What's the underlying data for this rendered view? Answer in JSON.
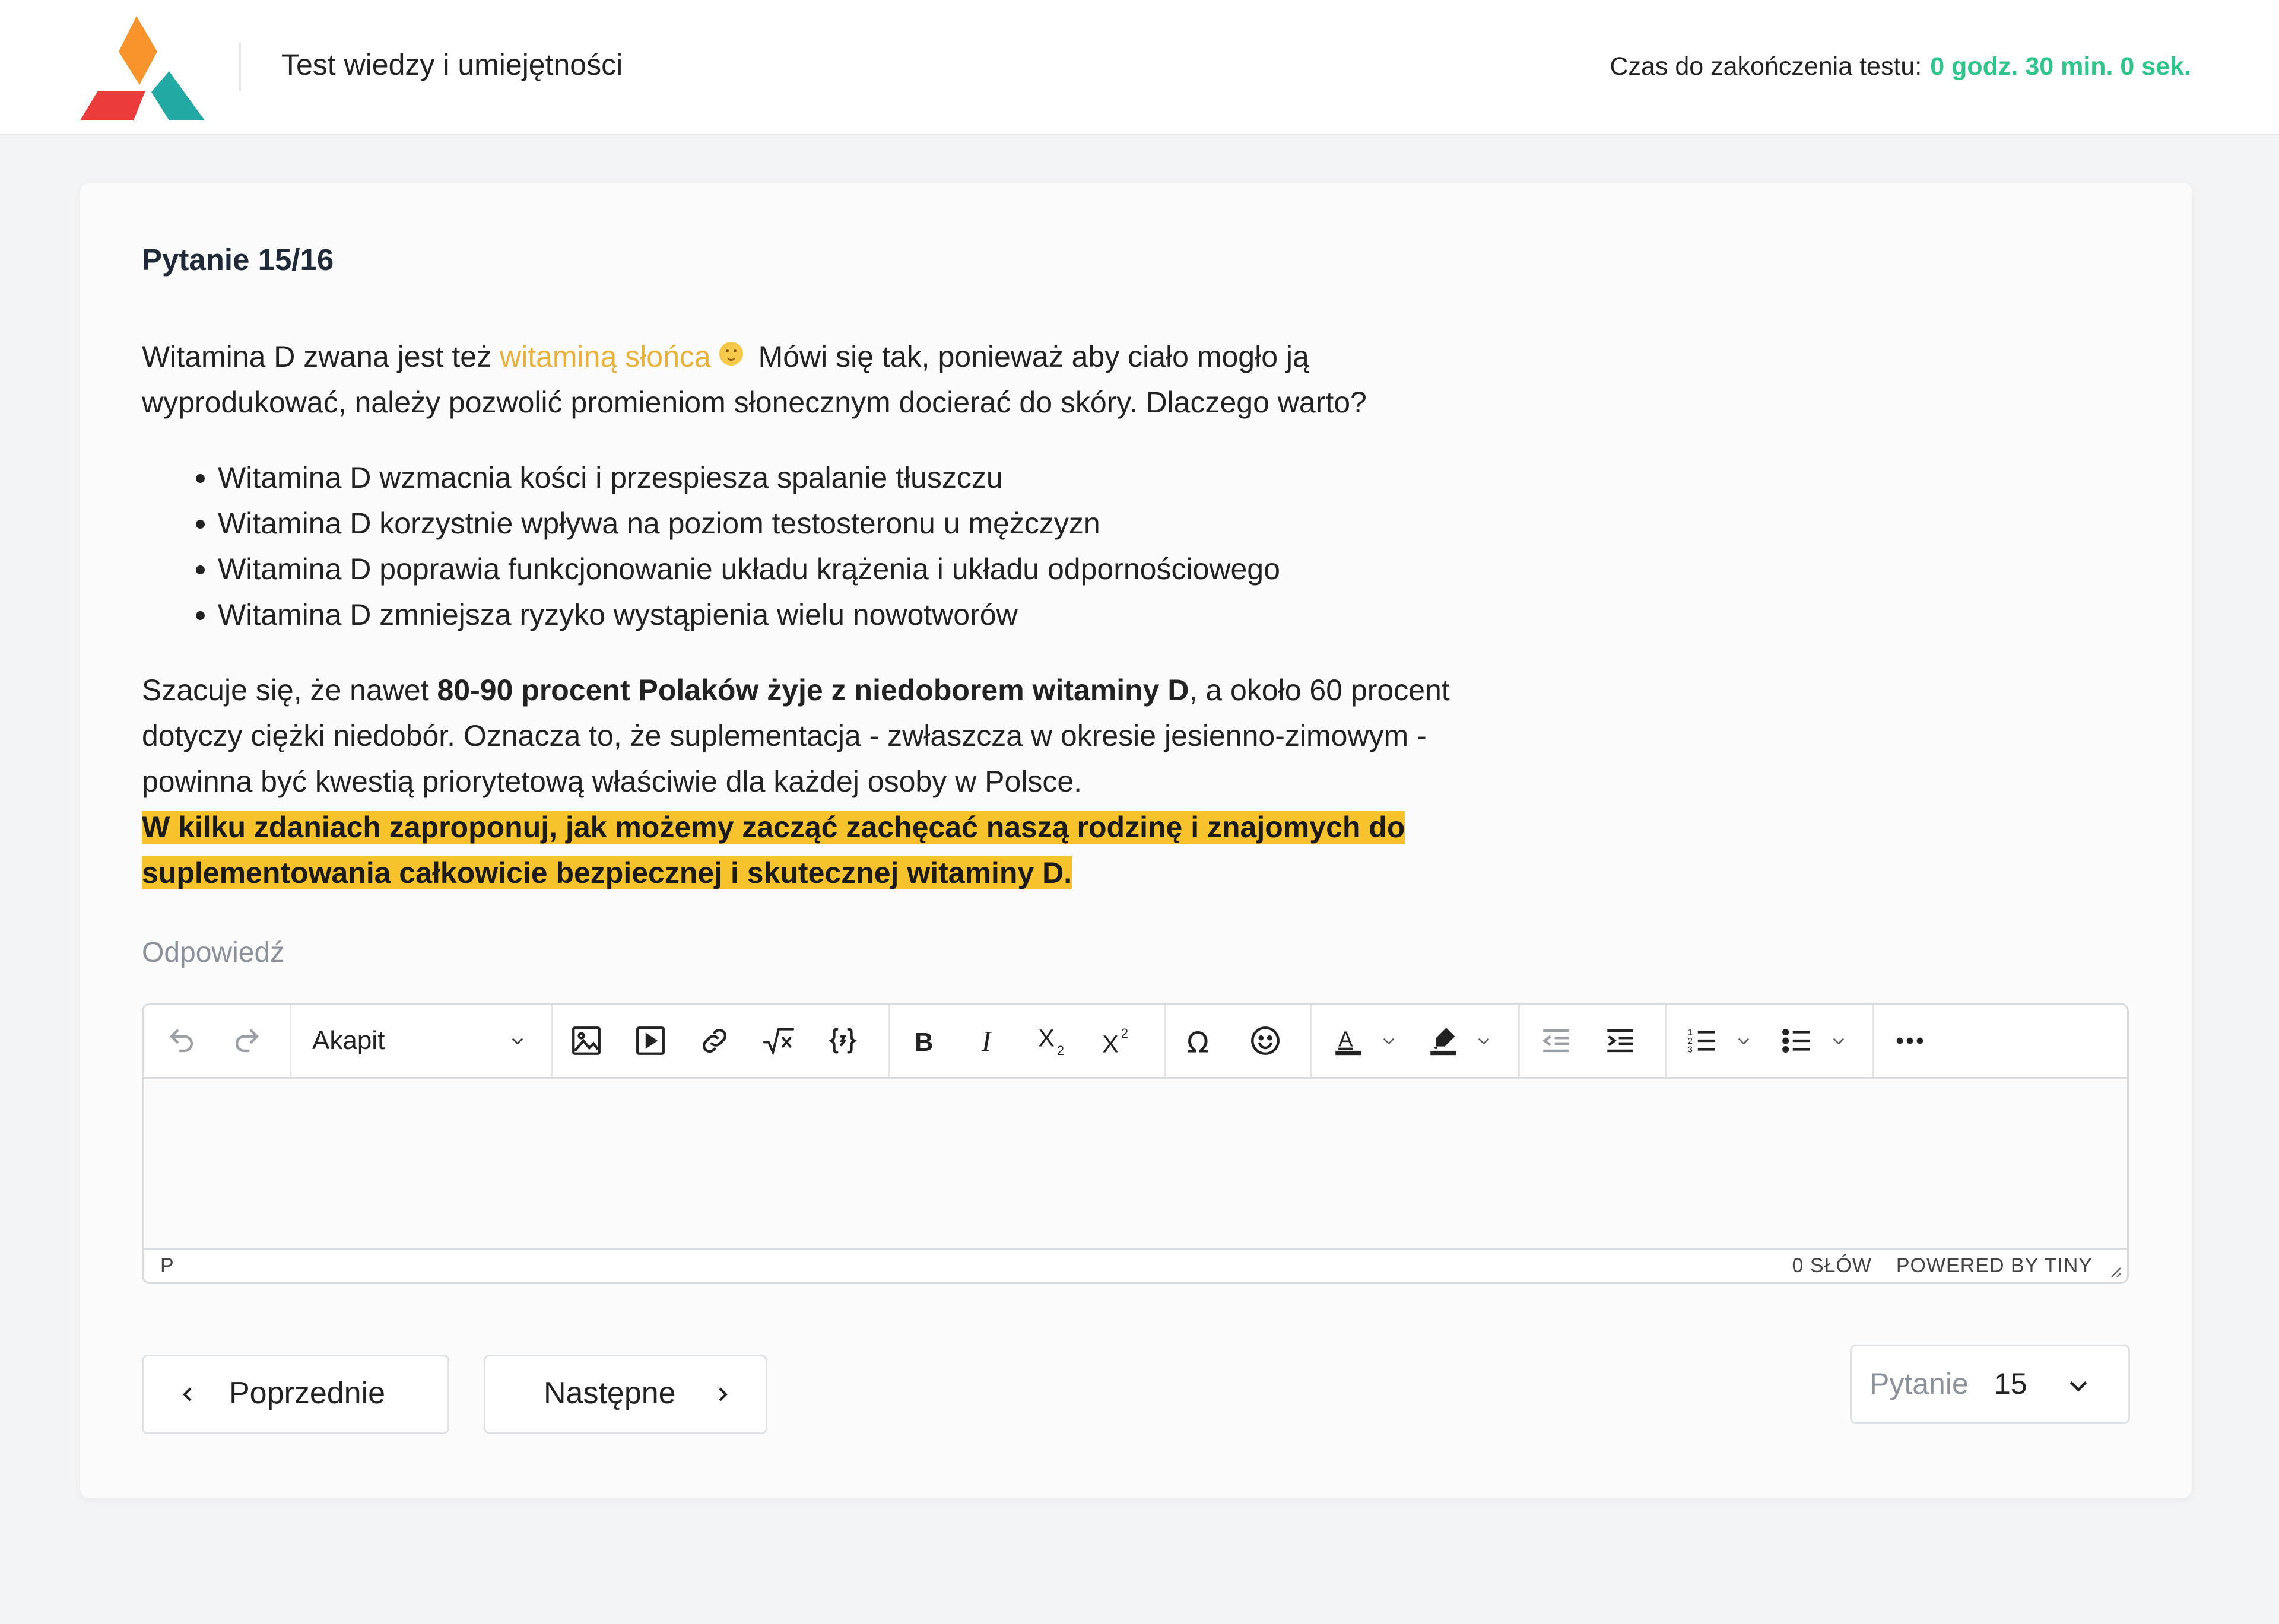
{
  "header": {
    "app_title": "Test wiedzy i umiejętności",
    "timer_label": "Czas do zakończenia testu:",
    "timer_value": "0 godz. 30 min. 0 sek.",
    "logo_icon": "triangle-logo-icon",
    "colors": {
      "logo_orange": "#f7942b",
      "logo_red": "#ec3b3b",
      "logo_teal": "#23a9a4",
      "timer_green": "#2ec58a"
    }
  },
  "question": {
    "number_label": "Pytanie 15/16",
    "intro_before": "Witamina D zwana jest też ",
    "intro_link": "witaminą słońca",
    "intro_emoji": "smiling-sun-emoji-icon",
    "intro_after": " Mówi się tak, ponieważ aby ciało mogło ją wyprodukować, należy pozwolić promieniom słonecznym docierać do skóry. Dlaczego warto?",
    "list": [
      "Witamina D wzmacnia kości i przespiesza spalanie tłuszczu",
      "Witamina D korzystnie wpływa na poziom testosteronu u mężczyzn",
      "Witamina D poprawia funkcjonowanie układu krążenia i układu odpornościowego",
      "Witamina D zmniejsza ryzyko wystąpienia wielu nowotworów"
    ],
    "stat_before": "Szacuje się, że nawet ",
    "stat_bold": "80-90 procent Polaków żyje z niedoborem witaminy D",
    "stat_after": ", a około 60 procent dotyczy ciężki niedobór. Oznacza to, że suplementacja - zwłaszcza w okresie jesienno-zimowym - powinna być kwestią priorytetową właściwie dla każdej osoby w Polsce.",
    "task": "W kilku zdaniach zaproponuj, jak możemy zacząć zachęcać naszą rodzinę i znajomych do suplementowania całkowicie bezpiecznej i skutecznej witaminy D.",
    "colors": {
      "link": "#e8b23a",
      "highlight": "#f6c32c"
    }
  },
  "answer": {
    "label": "Odpowiedź",
    "editor": {
      "block_format": "Akapit",
      "content": "",
      "status_path": "P",
      "word_count": "0 SŁÓW",
      "branding": "POWERED BY TINY",
      "toolbar_icons": [
        "undo-icon",
        "redo-icon",
        "image-icon",
        "media-icon",
        "link-icon",
        "math-icon",
        "code-sample-icon",
        "bold-icon",
        "italic-icon",
        "subscript-icon",
        "superscript-icon",
        "special-char-icon",
        "emoji-icon",
        "text-color-icon",
        "highlight-color-icon",
        "outdent-icon",
        "indent-icon",
        "numbered-list-icon",
        "bullet-list-icon",
        "more-icon"
      ]
    }
  },
  "navigation": {
    "prev_label": "Poprzednie",
    "next_label": "Następne",
    "question_select_label": "Pytanie",
    "question_select_value": "15"
  }
}
